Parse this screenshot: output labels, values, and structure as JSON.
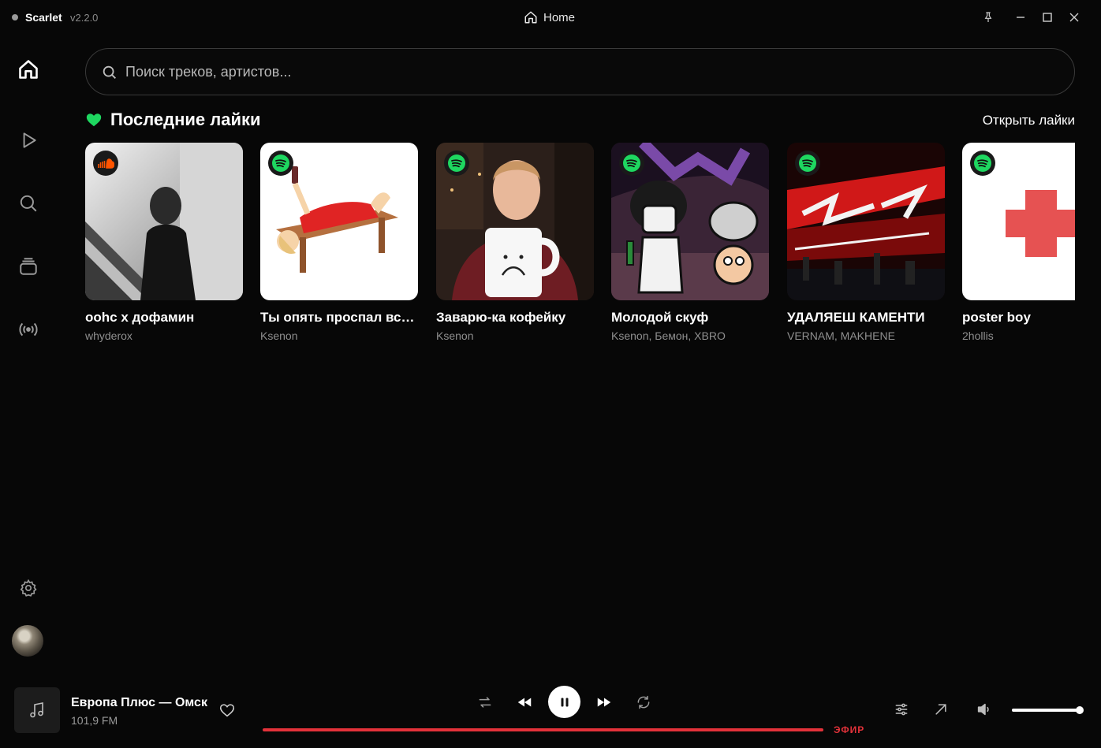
{
  "app": {
    "name": "Scarlet",
    "version": "v2.2.0"
  },
  "titlebar": {
    "page": "Home"
  },
  "search": {
    "placeholder": "Поиск треков, артистов..."
  },
  "section": {
    "title": "Последние лайки",
    "open_link": "Открыть лайки"
  },
  "cards": [
    {
      "title": "oohc x дофамин",
      "artist": "whyderox",
      "source": "soundcloud"
    },
    {
      "title": "Ты опять проспал всё на свете",
      "artist": "Ksenon",
      "source": "spotify"
    },
    {
      "title": "Заварю-ка кофейку",
      "artist": "Ksenon",
      "source": "spotify"
    },
    {
      "title": "Молодой скуф",
      "artist": "Ksenon, Бемон, XBRO",
      "source": "spotify"
    },
    {
      "title": "УДАЛЯЕШ КАМЕНТИ",
      "artist": "VERNAM, MAKHENE",
      "source": "spotify"
    },
    {
      "title": "poster boy",
      "artist": "2hollis",
      "source": "spotify"
    }
  ],
  "player": {
    "title": "Европа Плюс — Омск",
    "subtitle": "101,9 FM",
    "live_label": "ЭФИР",
    "progress": 1.0,
    "volume": 1.0
  },
  "colors": {
    "accent": "#e3323a",
    "spotify": "#1ed760",
    "soundcloud": "#ff5500",
    "heart": "#1ed760"
  }
}
